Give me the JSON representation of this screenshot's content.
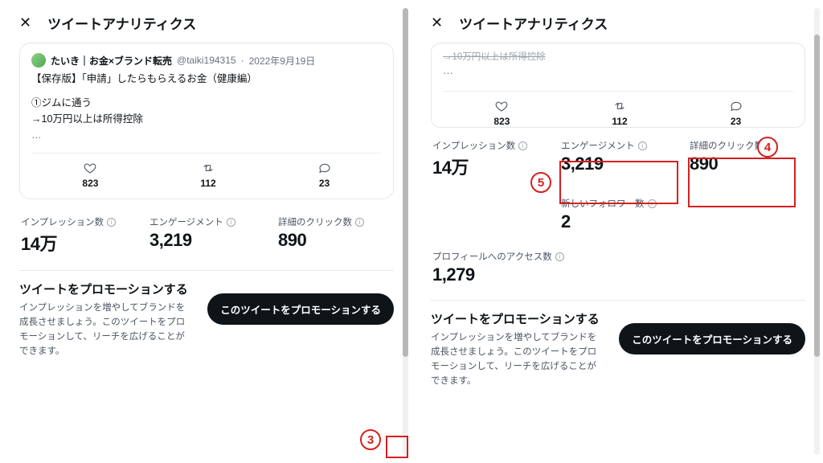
{
  "title": "ツイートアナリティクス",
  "tweet": {
    "username": "たいき｜お金×ブランド転売",
    "handle": "@taiki194315",
    "date": "2022年9月19日",
    "line1": "【保存版】「申請」したらもらえるお金（健康編）",
    "line2": "①ジムに通う",
    "line3": "→10万円以上は所得控除",
    "ellipsis": "…"
  },
  "engage": {
    "likes": "823",
    "retweets": "112",
    "replies": "23"
  },
  "metrics": {
    "impressions": {
      "label": "インプレッション数",
      "value": "14万"
    },
    "engagements": {
      "label": "エンゲージメント",
      "value": "3,219"
    },
    "detail_clicks": {
      "label": "詳細のクリック数",
      "value": "890"
    },
    "new_followers": {
      "label": "新しいフォロワー数",
      "value": "2"
    },
    "profile_visits": {
      "label": "プロフィールへのアクセス数",
      "value": "1,279"
    }
  },
  "promo": {
    "title": "ツイートをプロモーションする",
    "desc": "インプレッションを増やしてブランドを成長させましょう。このツイートをプロモーションして、リーチを広げることができます。",
    "button": "このツイートをプロモーションする"
  },
  "annotations": {
    "a3": "3",
    "a4": "4",
    "a5": "5"
  },
  "right_snippet_line": "→10万円以上は所得控除"
}
